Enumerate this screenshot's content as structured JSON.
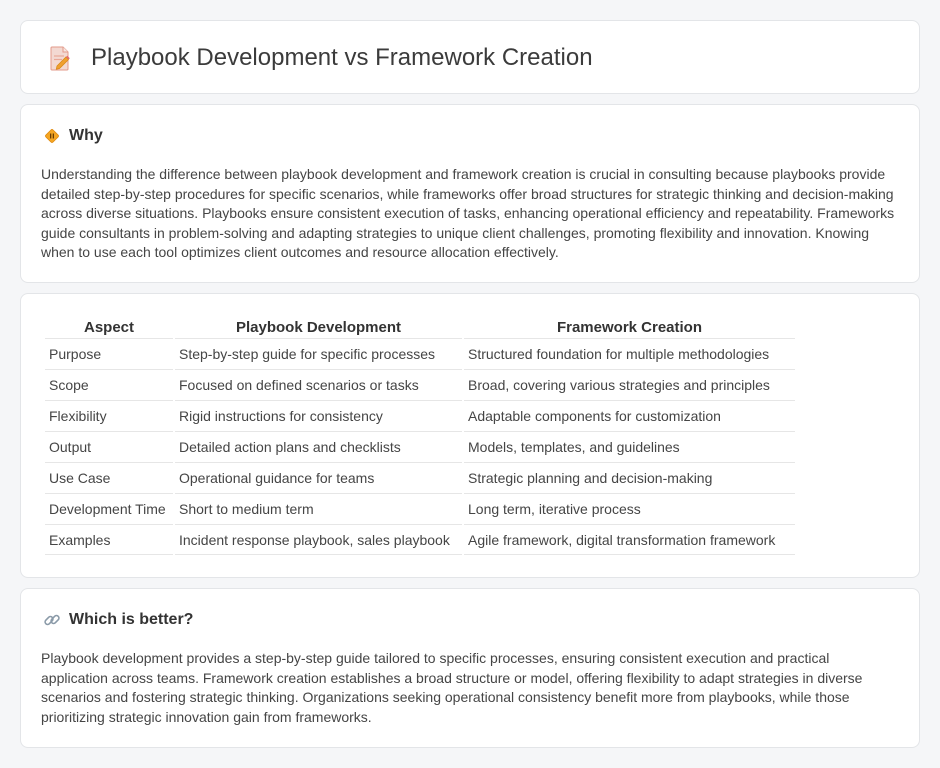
{
  "header": {
    "title": "Playbook Development vs Framework Creation",
    "icon": "edit-document-icon"
  },
  "why": {
    "icon": "diamond-warning-icon",
    "heading": "Why",
    "text": "Understanding the difference between playbook development and framework creation is crucial in consulting because playbooks provide detailed step-by-step procedures for specific scenarios, while frameworks offer broad structures for strategic thinking and decision-making across diverse situations. Playbooks ensure consistent execution of tasks, enhancing operational efficiency and repeatability. Frameworks guide consultants in problem-solving and adapting strategies to unique client challenges, promoting flexibility and innovation. Knowing when to use each tool optimizes client outcomes and resource allocation effectively."
  },
  "table": {
    "headers": [
      "Aspect",
      "Playbook Development",
      "Framework Creation"
    ],
    "rows": [
      [
        "Purpose",
        "Step-by-step guide for specific processes",
        "Structured foundation for multiple methodologies"
      ],
      [
        "Scope",
        "Focused on defined scenarios or tasks",
        "Broad, covering various strategies and principles"
      ],
      [
        "Flexibility",
        "Rigid instructions for consistency",
        "Adaptable components for customization"
      ],
      [
        "Output",
        "Detailed action plans and checklists",
        "Models, templates, and guidelines"
      ],
      [
        "Use Case",
        "Operational guidance for teams",
        "Strategic planning and decision-making"
      ],
      [
        "Development Time",
        "Short to medium term",
        "Long term, iterative process"
      ],
      [
        "Examples",
        "Incident response playbook, sales playbook",
        "Agile framework, digital transformation framework"
      ]
    ]
  },
  "better": {
    "icon": "link-icon",
    "heading": "Which is better?",
    "text": "Playbook development provides a step-by-step guide tailored to specific processes, ensuring consistent execution and practical application across teams. Framework creation establishes a broad structure or model, offering flexibility to adapt strategies in diverse scenarios and fostering strategic thinking. Organizations seeking operational consistency benefit more from playbooks, while those prioritizing strategic innovation gain from frameworks."
  },
  "colors": {
    "background": "#f5f6f8",
    "card": "#ffffff",
    "accent_orange": "#f0a030",
    "icon_pink": "#e88a8a"
  }
}
